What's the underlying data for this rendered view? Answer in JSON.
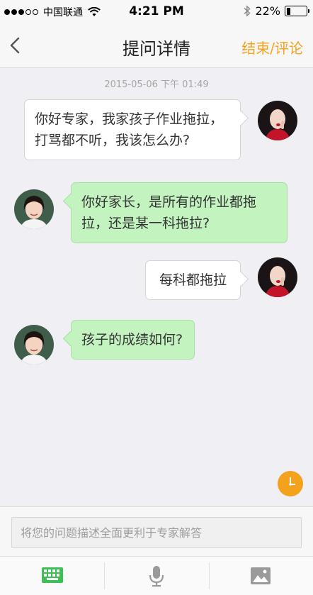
{
  "status_bar": {
    "carrier": "中国联通",
    "time": "4:21 PM",
    "battery_percent": "22%",
    "battery_level": 0.22,
    "signal_bars": 3,
    "icons": [
      "signal-icon",
      "wifi-icon",
      "bluetooth-icon",
      "battery-icon"
    ]
  },
  "nav": {
    "back_icon": "chevron-left-icon",
    "title": "提问详情",
    "action_label": "结束/评论",
    "accent_color": "#f4a21c"
  },
  "chat": {
    "timestamp": "2015-05-06 下午 01:49",
    "messages": [
      {
        "sender": "user",
        "text": "你好专家，我家孩子作业拖拉，打骂都不听，我该怎么办?"
      },
      {
        "sender": "expert",
        "text": "你好家长，是所有的作业都拖拉，还是某一科拖拉?"
      },
      {
        "sender": "user",
        "text": "每科都拖拉"
      },
      {
        "sender": "expert",
        "text": "孩子的成绩如何?"
      }
    ],
    "user_bubble_color": "#ffffff",
    "expert_bubble_color": "#c3f4c0"
  },
  "input": {
    "placeholder": "将您的问题描述全面更利于专家解答",
    "value": ""
  },
  "toolbar": {
    "items": [
      {
        "icon": "keyboard-icon",
        "color": "#3dbf55",
        "active": true
      },
      {
        "icon": "microphone-icon",
        "color": "#9a9a9a",
        "active": false
      },
      {
        "icon": "image-icon",
        "color": "#9a9a9a",
        "active": false
      }
    ]
  },
  "floating": {
    "icon": "clock-icon"
  }
}
